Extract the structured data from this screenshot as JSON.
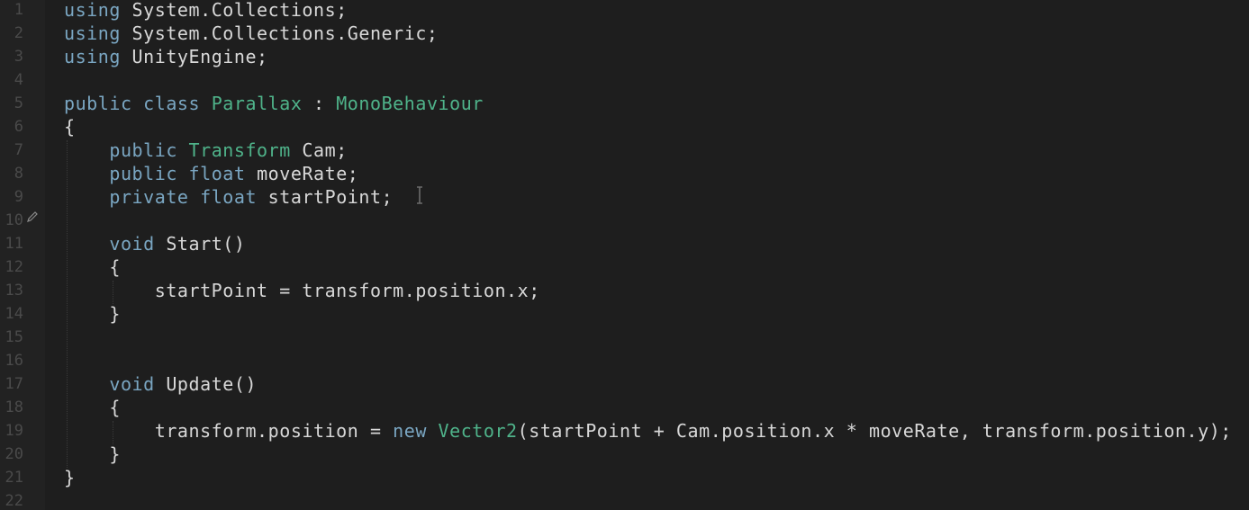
{
  "editor": {
    "language_hint": "csharp",
    "lines": [
      {
        "n": "1",
        "tokens": [
          {
            "t": "using",
            "c": "kw"
          },
          {
            "t": " System.Collections;",
            "c": "plain"
          }
        ]
      },
      {
        "n": "2",
        "tokens": [
          {
            "t": "using",
            "c": "kw"
          },
          {
            "t": " System.Collections.Generic;",
            "c": "plain"
          }
        ]
      },
      {
        "n": "3",
        "tokens": [
          {
            "t": "using",
            "c": "kw"
          },
          {
            "t": " UnityEngine;",
            "c": "plain"
          }
        ]
      },
      {
        "n": "4",
        "tokens": []
      },
      {
        "n": "5",
        "tokens": [
          {
            "t": "public",
            "c": "kw"
          },
          {
            "t": " ",
            "c": "plain"
          },
          {
            "t": "class",
            "c": "kw"
          },
          {
            "t": " ",
            "c": "plain"
          },
          {
            "t": "Parallax",
            "c": "type"
          },
          {
            "t": " : ",
            "c": "plain"
          },
          {
            "t": "MonoBehaviour",
            "c": "type"
          }
        ]
      },
      {
        "n": "6",
        "tokens": [
          {
            "t": "{",
            "c": "plain"
          }
        ]
      },
      {
        "n": "7",
        "tokens": [
          {
            "t": "    ",
            "c": "plain"
          },
          {
            "t": "public",
            "c": "kw"
          },
          {
            "t": " ",
            "c": "plain"
          },
          {
            "t": "Transform",
            "c": "type"
          },
          {
            "t": " Cam;",
            "c": "plain"
          }
        ]
      },
      {
        "n": "8",
        "tokens": [
          {
            "t": "    ",
            "c": "plain"
          },
          {
            "t": "public",
            "c": "kw"
          },
          {
            "t": " ",
            "c": "plain"
          },
          {
            "t": "float",
            "c": "kw"
          },
          {
            "t": " moveRate;",
            "c": "plain"
          }
        ]
      },
      {
        "n": "9",
        "tokens": [
          {
            "t": "    ",
            "c": "plain"
          },
          {
            "t": "private",
            "c": "kw"
          },
          {
            "t": " ",
            "c": "plain"
          },
          {
            "t": "float",
            "c": "kw"
          },
          {
            "t": " startPoint;",
            "c": "plain"
          }
        ]
      },
      {
        "n": "10",
        "tokens": []
      },
      {
        "n": "11",
        "tokens": [
          {
            "t": "    ",
            "c": "plain"
          },
          {
            "t": "void",
            "c": "kw"
          },
          {
            "t": " Start()",
            "c": "plain"
          }
        ]
      },
      {
        "n": "12",
        "tokens": [
          {
            "t": "    {",
            "c": "plain"
          }
        ]
      },
      {
        "n": "13",
        "tokens": [
          {
            "t": "        startPoint = transform.position.x;",
            "c": "plain"
          }
        ]
      },
      {
        "n": "14",
        "tokens": [
          {
            "t": "    }",
            "c": "plain"
          }
        ]
      },
      {
        "n": "15",
        "tokens": []
      },
      {
        "n": "16",
        "tokens": []
      },
      {
        "n": "17",
        "tokens": [
          {
            "t": "    ",
            "c": "plain"
          },
          {
            "t": "void",
            "c": "kw"
          },
          {
            "t": " Update()",
            "c": "plain"
          }
        ]
      },
      {
        "n": "18",
        "tokens": [
          {
            "t": "    {",
            "c": "plain"
          }
        ]
      },
      {
        "n": "19",
        "tokens": [
          {
            "t": "        transform.position = ",
            "c": "plain"
          },
          {
            "t": "new",
            "c": "kw"
          },
          {
            "t": " ",
            "c": "plain"
          },
          {
            "t": "Vector2",
            "c": "type"
          },
          {
            "t": "(startPoint + Cam.position.x * moveRate, transform.position.y);",
            "c": "plain"
          }
        ]
      },
      {
        "n": "20",
        "tokens": [
          {
            "t": "    }",
            "c": "plain"
          }
        ]
      },
      {
        "n": "21",
        "tokens": [
          {
            "t": "}",
            "c": "plain"
          }
        ]
      },
      {
        "n": "22",
        "tokens": []
      }
    ],
    "colors": {
      "background": "#1e1e1e",
      "gutter": "#222222",
      "line_number": "#4a4a4a",
      "keyword": "#7aa6c2",
      "type": "#4fb38a",
      "text": "#d8d8d8"
    },
    "icons": {
      "edit_marker": "pencil-icon",
      "text_cursor": "ibeam-cursor-icon"
    }
  }
}
